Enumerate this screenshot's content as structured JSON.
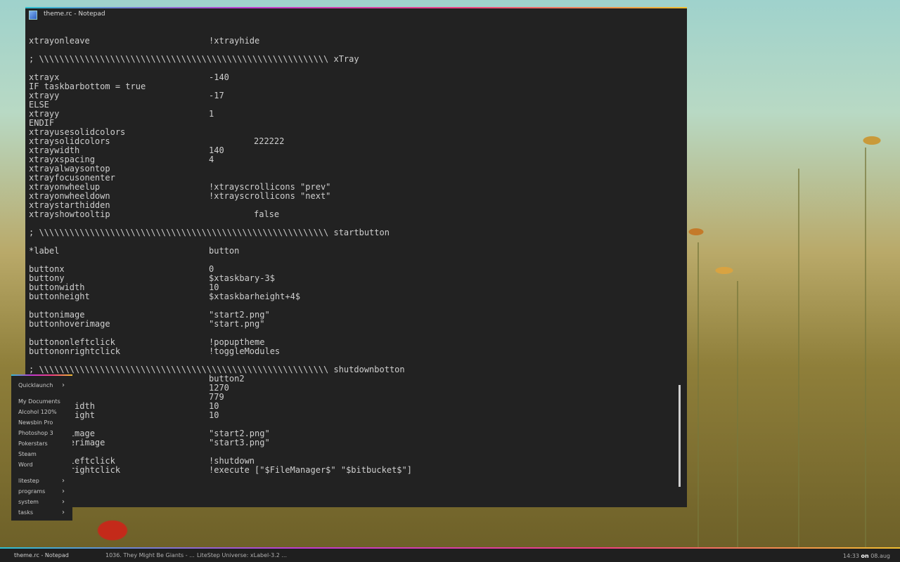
{
  "window": {
    "title": "theme.rc - Notepad"
  },
  "editor_lines": [
    {
      "k": "xtrayonleave",
      "v": "!xtrayhide"
    },
    {
      "k": "",
      "v": ""
    },
    {
      "k": "; \\\\\\\\\\\\\\\\\\\\\\\\\\\\\\\\\\\\\\\\\\\\\\\\\\\\\\\\\\\\\\\\\\\\\\\\\\\\\\\\\\\\\\\\\\\\\\\\\\\\\\\\\\\\\\\\\\ xTray",
      "v": ""
    },
    {
      "k": "",
      "v": ""
    },
    {
      "k": "xtrayx",
      "v": "-140"
    },
    {
      "k": "IF taskbarbottom = true",
      "v": ""
    },
    {
      "k": "xtrayy",
      "v": "-17"
    },
    {
      "k": "ELSE",
      "v": ""
    },
    {
      "k": "xtrayy",
      "v": "1"
    },
    {
      "k": "ENDIF",
      "v": ""
    },
    {
      "k": "xtrayusesolidcolors",
      "v": ""
    },
    {
      "k": "xtraysolidcolors",
      "v": "222222",
      "wide": true
    },
    {
      "k": "xtraywidth",
      "v": "140"
    },
    {
      "k": "xtrayxspacing",
      "v": "4"
    },
    {
      "k": "xtrayalwaysontop",
      "v": ""
    },
    {
      "k": "xtrayfocusonenter",
      "v": ""
    },
    {
      "k": "xtrayonwheelup",
      "v": "!xtrayscrollicons \"prev\""
    },
    {
      "k": "xtrayonwheeldown",
      "v": "!xtrayscrollicons \"next\""
    },
    {
      "k": "xtraystarthidden",
      "v": ""
    },
    {
      "k": "xtrayshowtooltip",
      "v": "false",
      "wide": true
    },
    {
      "k": "",
      "v": ""
    },
    {
      "k": "; \\\\\\\\\\\\\\\\\\\\\\\\\\\\\\\\\\\\\\\\\\\\\\\\\\\\\\\\\\\\\\\\\\\\\\\\\\\\\\\\\\\\\\\\\\\\\\\\\\\\\\\\\\\\\\\\\\ startbutton",
      "v": ""
    },
    {
      "k": "",
      "v": ""
    },
    {
      "k": "*label",
      "v": "button"
    },
    {
      "k": "",
      "v": ""
    },
    {
      "k": "buttonx",
      "v": "0"
    },
    {
      "k": "buttony",
      "v": "$xtaskbary-3$"
    },
    {
      "k": "buttonwidth",
      "v": "10"
    },
    {
      "k": "buttonheight",
      "v": "$xtaskbarheight+4$"
    },
    {
      "k": "",
      "v": ""
    },
    {
      "k": "buttonimage",
      "v": "\"start2.png\""
    },
    {
      "k": "buttonhoverimage",
      "v": "\"start.png\""
    },
    {
      "k": "",
      "v": ""
    },
    {
      "k": "buttononleftclick",
      "v": "!popuptheme"
    },
    {
      "k": "buttononrightclick",
      "v": "!toggleModules"
    },
    {
      "k": "",
      "v": ""
    },
    {
      "k": "; \\\\\\\\\\\\\\\\\\\\\\\\\\\\\\\\\\\\\\\\\\\\\\\\\\\\\\\\\\\\\\\\\\\\\\\\\\\\\\\\\\\\\\\\\\\\\\\\\\\\\\\\\\\\\\\\\\ shutdownbotton",
      "v": ""
    },
    {
      "k": "",
      "v": "button2"
    },
    {
      "k": "",
      "v": "1270"
    },
    {
      "k": "",
      "v": "779"
    },
    {
      "k": "         idth",
      "v": "10"
    },
    {
      "k": "         ight",
      "v": "10"
    },
    {
      "k": "",
      "v": ""
    },
    {
      "k": "        image",
      "v": "\"start2.png\""
    },
    {
      "k": "      overimage",
      "v": "\"start3.png\""
    },
    {
      "k": "",
      "v": ""
    },
    {
      "k": "       nleftclick",
      "v": "!shutdown"
    },
    {
      "k": "       nrightclick",
      "v": "!execute [\"$FileManager$\" \"$bitbucket$\"]"
    }
  ],
  "popup_menu": {
    "items": [
      {
        "label": "Quicklaunch",
        "submenu": true
      },
      {
        "label": "My Documents",
        "submenu": false
      },
      {
        "label": "Alcohol 120%",
        "submenu": false
      },
      {
        "label": "Newsbin Pro",
        "submenu": false
      },
      {
        "label": "Photoshop 3",
        "submenu": false
      },
      {
        "label": "Pokerstars",
        "submenu": false
      },
      {
        "label": "Steam",
        "submenu": false
      },
      {
        "label": "Word",
        "submenu": false
      },
      {
        "label": "litestep",
        "submenu": true
      },
      {
        "label": "programs",
        "submenu": true
      },
      {
        "label": "system",
        "submenu": true
      },
      {
        "label": "tasks",
        "submenu": true
      }
    ],
    "arrow": "›"
  },
  "taskbar": {
    "tasks": [
      {
        "label": "theme.rc - Notepad"
      },
      {
        "label": "1036. They Might Be Giants - ..."
      },
      {
        "label": "LiteStep Universe: xLabel-3.2 ..."
      }
    ],
    "clock": {
      "time": "14:33",
      "sep": "on",
      "date": "08.aug"
    }
  }
}
